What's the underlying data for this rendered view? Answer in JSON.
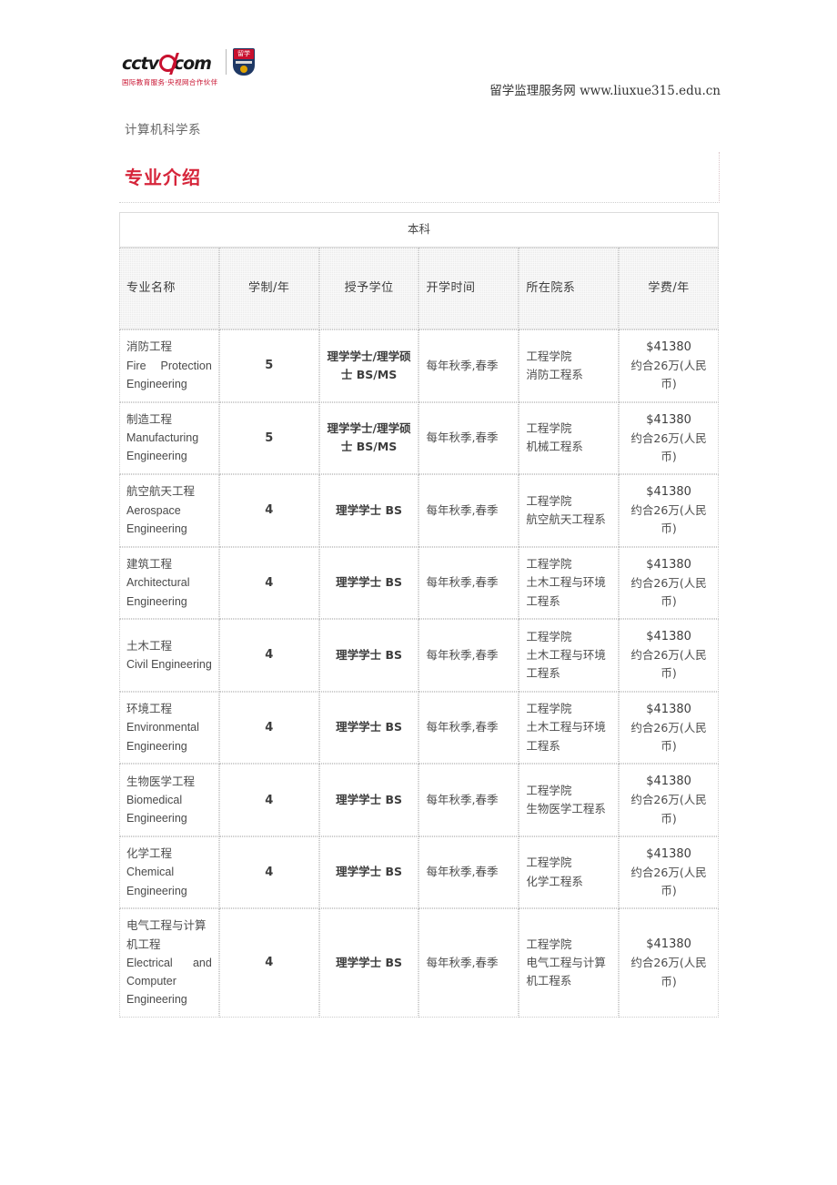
{
  "header": {
    "logo": {
      "brand_text": "cctv",
      "brand_suffix": "com",
      "badge_label": "留学",
      "tagline": "国际教育服务·央视网合作伙伴",
      "icon_ring": "cctv-ring-icon",
      "icon_shield": "shield-badge-icon"
    },
    "site_name": "留学监理服务网",
    "site_url": "www.liuxue315.edu.cn"
  },
  "department": "计算机科学系",
  "section": {
    "title": "专业介绍"
  },
  "table": {
    "caption": "本科",
    "columns": [
      "专业名称",
      "学制/年",
      "授予学位",
      "开学时间",
      "所在院系",
      "学费/年"
    ],
    "rows": [
      {
        "name_cn": "消防工程",
        "name_en": "Fire Protection Engineering",
        "justify": true,
        "years": "5",
        "degree": "理学学士/理学硕士 BS/MS",
        "start": "每年秋季,春季",
        "school": "工程学院",
        "dept": "消防工程系",
        "fee_usd": "$41380",
        "fee_cny": "约合26万(人民币)"
      },
      {
        "name_cn": "制造工程",
        "name_en": "Manufacturing Engineering",
        "justify": false,
        "years": "5",
        "degree": "理学学士/理学硕士 BS/MS",
        "start": "每年秋季,春季",
        "school": "工程学院",
        "dept": "机械工程系",
        "fee_usd": "$41380",
        "fee_cny": "约合26万(人民币)"
      },
      {
        "name_cn": "航空航天工程",
        "name_en": "Aerospace Engineering",
        "justify": false,
        "years": "4",
        "degree": "理学学士 BS",
        "start": "每年秋季,春季",
        "school": "工程学院",
        "dept": "航空航天工程系",
        "fee_usd": "$41380",
        "fee_cny": "约合26万(人民币)"
      },
      {
        "name_cn": "建筑工程",
        "name_en": "Architectural Engineering",
        "justify": false,
        "years": "4",
        "degree": "理学学士 BS",
        "start": "每年秋季,春季",
        "school": "工程学院",
        "dept": "土木工程与环境工程系",
        "fee_usd": "$41380",
        "fee_cny": "约合26万(人民币)"
      },
      {
        "name_cn": "土木工程",
        "name_en": "Civil Engineering",
        "justify": false,
        "years": "4",
        "degree": "理学学士 BS",
        "start": "每年秋季,春季",
        "school": "工程学院",
        "dept": "土木工程与环境工程系",
        "fee_usd": "$41380",
        "fee_cny": "约合26万(人民币)"
      },
      {
        "name_cn": "环境工程",
        "name_en": "Environmental Engineering",
        "justify": false,
        "years": "4",
        "degree": "理学学士 BS",
        "start": "每年秋季,春季",
        "school": "工程学院",
        "dept": "土木工程与环境工程系",
        "fee_usd": "$41380",
        "fee_cny": "约合26万(人民币)"
      },
      {
        "name_cn": "生物医学工程",
        "name_en": "Biomedical Engineering",
        "justify": false,
        "years": "4",
        "degree": "理学学士 BS",
        "start": "每年秋季,春季",
        "school": "工程学院",
        "dept": "生物医学工程系",
        "fee_usd": "$41380",
        "fee_cny": "约合26万(人民币)"
      },
      {
        "name_cn": "化学工程",
        "name_en": "Chemical Engineering",
        "justify": false,
        "years": "4",
        "degree": "理学学士 BS",
        "start": "每年秋季,春季",
        "school": "工程学院",
        "dept": "化学工程系",
        "fee_usd": "$41380",
        "fee_cny": "约合26万(人民币)"
      },
      {
        "name_cn": "电气工程与计算机工程",
        "name_en": "Electrical and Computer Engineering",
        "justify": true,
        "years": "4",
        "degree": "理学学士 BS",
        "start": "每年秋季,春季",
        "school": "工程学院",
        "dept": "电气工程与计算机工程系",
        "fee_usd": "$41380",
        "fee_cny": "约合26万(人民币)"
      }
    ]
  },
  "colors": {
    "heading_red": "#d6253a",
    "logo_red": "#c8102e",
    "header_bg": "#ebebeb",
    "border": "#cccccc",
    "text": "#4a4a4a"
  }
}
